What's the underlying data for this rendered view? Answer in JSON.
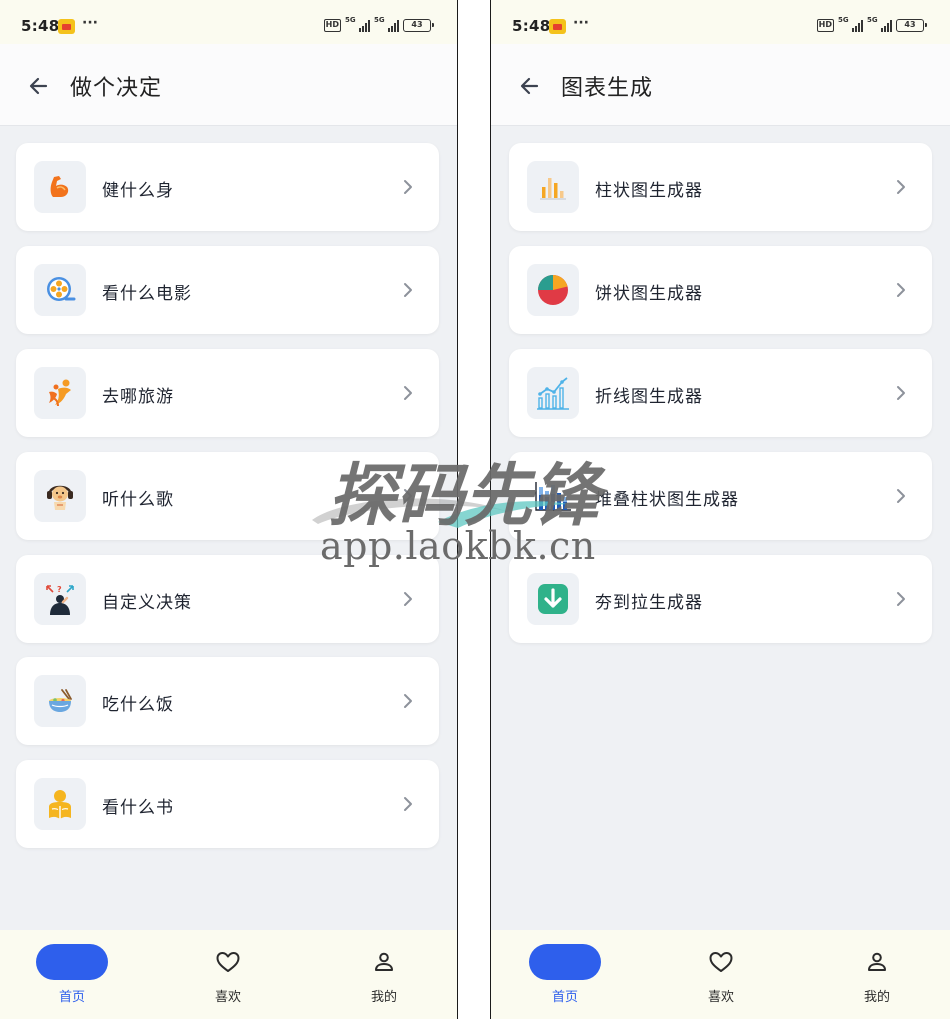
{
  "status_bar": {
    "time": "5:48",
    "dots": "···",
    "hd": "HD",
    "network": "5G",
    "battery": "43"
  },
  "left_screen": {
    "title": "做个决定",
    "items": [
      {
        "label": "健什么身",
        "icon": "flexed-bicep-icon"
      },
      {
        "label": "看什么电影",
        "icon": "film-reel-icon"
      },
      {
        "label": "去哪旅游",
        "icon": "travel-people-icon"
      },
      {
        "label": "听什么歌",
        "icon": "dog-headphones-icon"
      },
      {
        "label": "自定义决策",
        "icon": "thinking-person-icon"
      },
      {
        "label": "吃什么饭",
        "icon": "noodle-bowl-icon"
      },
      {
        "label": "看什么书",
        "icon": "person-reading-icon"
      }
    ]
  },
  "right_screen": {
    "title": "图表生成",
    "items": [
      {
        "label": "柱状图生成器",
        "icon": "bar-chart-icon"
      },
      {
        "label": "饼状图生成器",
        "icon": "pie-chart-icon"
      },
      {
        "label": "折线图生成器",
        "icon": "line-chart-icon"
      },
      {
        "label": "堆叠柱状图生成器",
        "icon": "stacked-bar-chart-icon"
      },
      {
        "label": "夯到拉生成器",
        "icon": "download-arrow-icon"
      }
    ]
  },
  "bottom_nav": [
    {
      "label": "首页",
      "icon": "home-icon",
      "active": true
    },
    {
      "label": "喜欢",
      "icon": "heart-icon",
      "active": false
    },
    {
      "label": "我的",
      "icon": "user-icon",
      "active": false
    }
  ],
  "watermark": {
    "brand": "探码先锋",
    "url": "app.laokbk.cn"
  },
  "colors": {
    "accent": "#2e5fec",
    "background": "#eff1f4",
    "bar_bg": "#fbfbf0"
  }
}
